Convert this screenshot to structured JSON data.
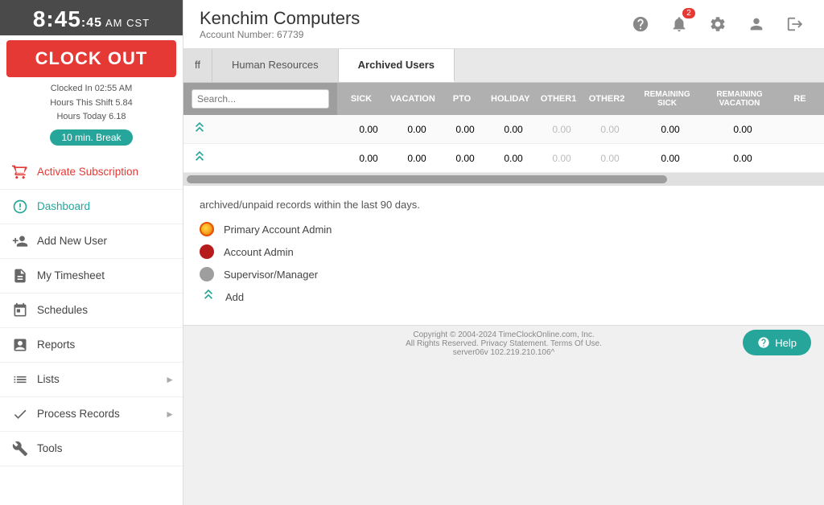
{
  "sidebar": {
    "time": "8:45",
    "seconds": ":45",
    "ampm_tz": "AM CST",
    "clock_out_label": "CLOCK OUT",
    "clocked_in": "Clocked In 02:55 AM",
    "hours_shift": "Hours This Shift 5.84",
    "hours_today": "Hours Today 6.18",
    "break_label": "10 min. Break",
    "nav_items": [
      {
        "id": "activate-subscription",
        "label": "Activate Subscription",
        "icon": "cart",
        "special": true
      },
      {
        "id": "dashboard",
        "label": "Dashboard",
        "icon": "dashboard",
        "active": true
      },
      {
        "id": "add-new-user",
        "label": "Add New User",
        "icon": "add-user"
      },
      {
        "id": "my-timesheet",
        "label": "My Timesheet",
        "icon": "timesheet"
      },
      {
        "id": "schedules",
        "label": "Schedules",
        "icon": "calendar"
      },
      {
        "id": "reports",
        "label": "Reports",
        "icon": "reports"
      },
      {
        "id": "lists",
        "label": "Lists",
        "icon": "lists",
        "arrow": true
      },
      {
        "id": "process-records",
        "label": "Process Records",
        "icon": "check",
        "arrow": true
      },
      {
        "id": "tools",
        "label": "Tools",
        "icon": "tools"
      }
    ]
  },
  "header": {
    "company_name": "Kenchim Computers",
    "account_number_label": "Account Number: 67739",
    "notification_count": "2"
  },
  "tabs": [
    {
      "id": "off",
      "label": "ff",
      "active": false
    },
    {
      "id": "human-resources",
      "label": "Human Resources",
      "active": false
    },
    {
      "id": "archived-users",
      "label": "Archived Users",
      "active": true
    }
  ],
  "table": {
    "columns": [
      "SICK",
      "VACATION",
      "PTO",
      "HOLIDAY",
      "OTHER1",
      "OTHER2",
      "REMAINING SICK",
      "REMAINING VACATION",
      "RE"
    ],
    "rows": [
      {
        "values": [
          "0.00",
          "0.00",
          "0.00",
          "0.00",
          "0.00",
          "0.00",
          "0.00",
          "0.00"
        ],
        "muted": [
          false,
          false,
          false,
          false,
          true,
          true,
          false,
          false
        ]
      },
      {
        "values": [
          "0.00",
          "0.00",
          "0.00",
          "0.00",
          "0.00",
          "0.00",
          "0.00",
          "0.00"
        ],
        "muted": [
          false,
          false,
          false,
          false,
          true,
          true,
          false,
          false
        ]
      }
    ]
  },
  "legend": {
    "notice": "archived/unpaid records within the last 90 days.",
    "items": [
      {
        "id": "primary-admin",
        "label": "Primary Account Admin",
        "color": "#f9a825",
        "type": "dot"
      },
      {
        "id": "account-admin",
        "label": "Account Admin",
        "color": "#b71c1c",
        "type": "dot"
      },
      {
        "id": "supervisor",
        "label": "Supervisor/Manager",
        "color": "#9e9e9e",
        "type": "dot"
      },
      {
        "id": "add",
        "label": "Add",
        "type": "icon"
      }
    ]
  },
  "footer": {
    "copyright": "Copyright © 2004-2024 TimeClockOnline.com, Inc.",
    "rights": "All Rights Reserved. Privacy Statement. Terms Of Use.",
    "server": "server06v 102.219.210.106^",
    "help_label": "Help"
  }
}
